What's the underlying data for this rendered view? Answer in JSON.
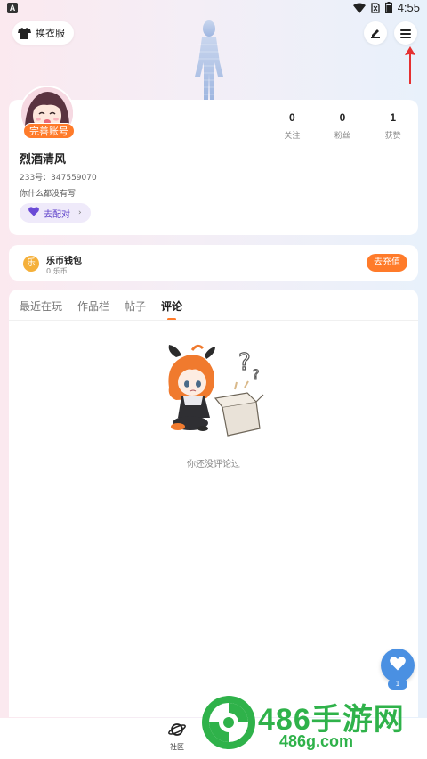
{
  "status_bar": {
    "app_letter": "A",
    "time": "4:55"
  },
  "header": {
    "outfit_button_label": "换衣服",
    "icons": [
      "tshirt-icon",
      "edit-icon",
      "menu-icon"
    ]
  },
  "profile": {
    "complete_badge": "完善账号",
    "username": "烈酒清风",
    "uid": "233号：347559070",
    "bio": "你什么都没有写",
    "pair_button_label": "去配对",
    "stats": [
      {
        "value": "0",
        "label": "关注"
      },
      {
        "value": "0",
        "label": "粉丝"
      },
      {
        "value": "1",
        "label": "获赞"
      }
    ]
  },
  "wallet": {
    "coin_glyph": "乐",
    "title": "乐币钱包",
    "balance": "0 乐币",
    "recharge_label": "去充值"
  },
  "content": {
    "tabs": [
      {
        "label": "最近在玩",
        "active": false
      },
      {
        "label": "作品栏",
        "active": false
      },
      {
        "label": "帖子",
        "active": false
      },
      {
        "label": "评论",
        "active": true
      }
    ],
    "empty_text": "你还没评论过"
  },
  "fab": {
    "count": "1"
  },
  "bottom_nav": {
    "community_label": "社区"
  },
  "watermark": {
    "text": "486手游网",
    "url": "486g.com"
  },
  "colors": {
    "accent": "#ff7b2a",
    "pair": "#5c3fc9",
    "fab": "#4a90e2",
    "watermark": "#2fb24a"
  }
}
